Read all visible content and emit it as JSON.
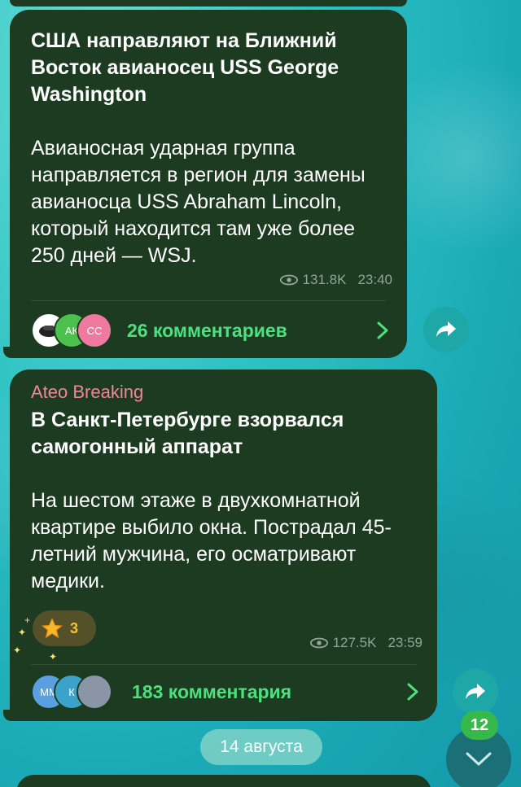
{
  "messages": [
    {
      "title": "США направляют на Ближний Восток авианосец USS George Washington",
      "text": "Авианосная ударная группа направляется в регион для замены авианосца USS Abraham Lincoln, который находится там уже более 250 дней — WSJ.",
      "views": "131.8K",
      "time": "23:40",
      "comments_label": "26 комментариев",
      "avatars": [
        {
          "initials": "",
          "color": "#ffffff"
        },
        {
          "initials": "АК",
          "color": "#4cc04c"
        },
        {
          "initials": "СС",
          "color": "#ef7aa0"
        }
      ]
    },
    {
      "sender": "Ateo Breaking",
      "title": "В Санкт-Петербурге взорвался самогонный аппарат",
      "text": "На шестом этаже в двухкомнатной квартире выбило окна. Пострадал 45-летний мужчина, его осматривают медики.",
      "views": "127.5K",
      "time": "23:59",
      "reaction_count": "3",
      "reaction_icon": "star-icon",
      "comments_label": "183 комментария",
      "avatars": [
        {
          "initials": "ММ",
          "color": "#5aa0e0"
        },
        {
          "initials": "К",
          "color": "#3ba3c9"
        },
        {
          "initials": "",
          "color": "#8a96a8"
        }
      ]
    }
  ],
  "date_separator": "14 августа",
  "unread_count": "12",
  "colors": {
    "bubble": "#1d3b21",
    "accent_green": "#4ee07e",
    "sender_pink": "#f1859a",
    "share_button": "#1ea7a7"
  }
}
